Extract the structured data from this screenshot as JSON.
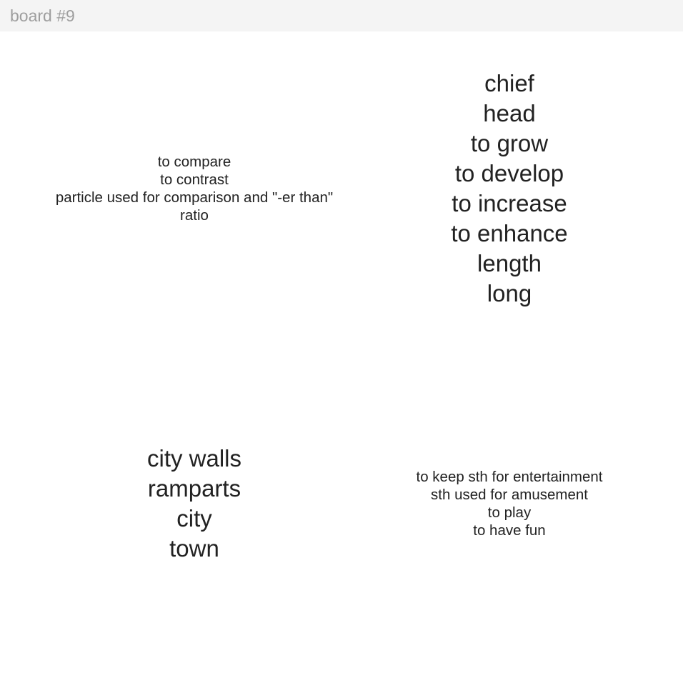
{
  "header": {
    "title": "board #9"
  },
  "cards": {
    "top_left": [
      "to compare",
      "to contrast",
      "particle used for comparison and \"-er than\"",
      "ratio"
    ],
    "top_right": [
      "chief",
      "head",
      "to grow",
      "to develop",
      "to increase",
      "to enhance",
      "length",
      "long"
    ],
    "bottom_left": [
      "city walls",
      "ramparts",
      "city",
      "town"
    ],
    "bottom_right": [
      "to keep sth for entertainment",
      "sth used for amusement",
      "to play",
      "to have fun"
    ]
  }
}
